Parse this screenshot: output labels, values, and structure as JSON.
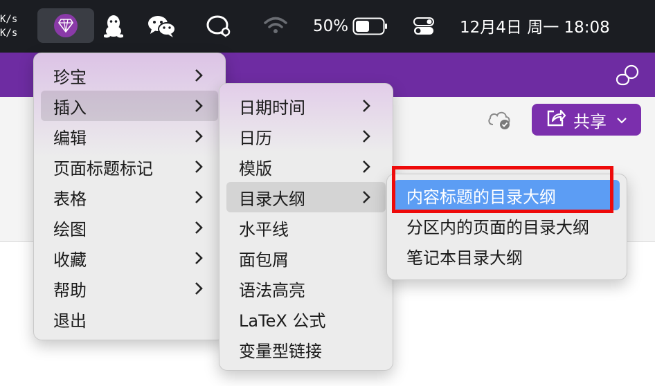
{
  "menubar": {
    "net_speed_up": "K/s",
    "net_speed_down": "K/s",
    "battery_percent": "50%",
    "datetime": "12月4日 周一  18:08",
    "icons": [
      "gem-app-icon",
      "qq-icon",
      "wechat-icon",
      "search-chat-icon",
      "wifi-icon",
      "battery-icon",
      "control-center-icon"
    ]
  },
  "app": {
    "share_label": "共享",
    "accent": "#6e2ca2"
  },
  "menu_main": {
    "items": [
      {
        "label": "珍宝",
        "submenu": true
      },
      {
        "label": "插入",
        "submenu": true,
        "selected": true
      },
      {
        "label": "编辑",
        "submenu": true
      },
      {
        "label": "页面标题标记",
        "submenu": true
      },
      {
        "label": "表格",
        "submenu": true
      },
      {
        "label": "绘图",
        "submenu": true
      },
      {
        "label": "收藏",
        "submenu": true
      },
      {
        "label": "帮助",
        "submenu": true
      },
      {
        "label": "退出",
        "submenu": false
      }
    ]
  },
  "menu_insert": {
    "items": [
      {
        "label": "日期时间",
        "submenu": true
      },
      {
        "label": "日历",
        "submenu": true
      },
      {
        "label": "模版",
        "submenu": true
      },
      {
        "label": "目录大纲",
        "submenu": true,
        "selected": true
      },
      {
        "label": "水平线",
        "submenu": false
      },
      {
        "label": "面包屑",
        "submenu": false
      },
      {
        "label": "语法高亮",
        "submenu": false
      },
      {
        "label": "LaTeX 公式",
        "submenu": false
      },
      {
        "label": "变量型链接",
        "submenu": false
      }
    ]
  },
  "menu_toc": {
    "items": [
      {
        "label": "内容标题的目录大纲",
        "highlighted": true
      },
      {
        "label": "分区内的页面的目录大纲"
      },
      {
        "label": "笔记本目录大纲"
      }
    ]
  },
  "annotation": {
    "color": "#ee0a0a"
  }
}
